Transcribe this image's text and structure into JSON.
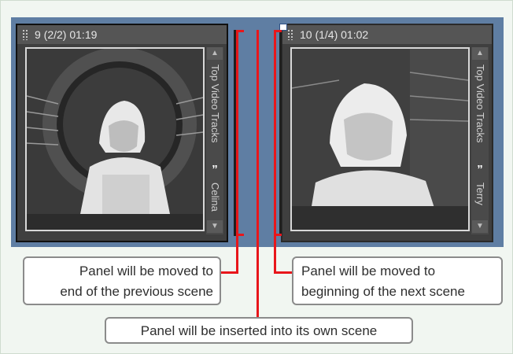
{
  "panels": [
    {
      "title": "9 (2/2) 01:19",
      "track_label": "Top Video Tracks",
      "track_name": "Celina",
      "quote_glyph": "”",
      "scroll_up_glyph": "▲",
      "scroll_down_glyph": "▼"
    },
    {
      "title": "10 (1/4) 01:02",
      "track_label": "Top Video Tracks",
      "track_name": "Terry",
      "quote_glyph": "”",
      "scroll_up_glyph": "▲",
      "scroll_down_glyph": "▼"
    }
  ],
  "callouts": {
    "previous_scene": {
      "line1": "Panel will be moved to",
      "line2": "end of the previous scene"
    },
    "next_scene": {
      "line1": "Panel will be moved to",
      "line2": "beginning of the next scene"
    },
    "own_scene": "Panel will be inserted into its own scene"
  },
  "colors": {
    "indicator_red": "#e8161b",
    "timeline_blue": "#5f7ea3",
    "panel_dark": "#3f3f3f",
    "header_gray": "#555555"
  }
}
